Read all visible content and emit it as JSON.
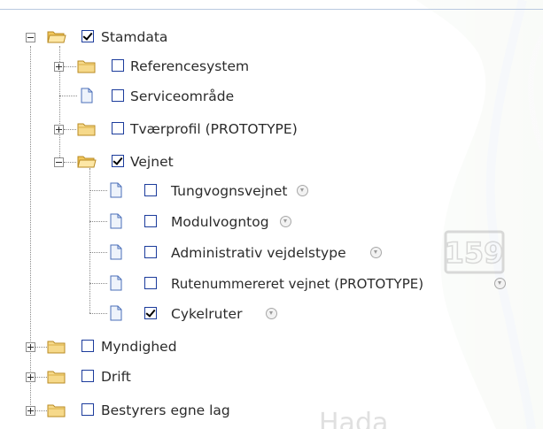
{
  "colors": {
    "accent_check_border": "#1c3c9c",
    "folder": "#f3d07a",
    "doc": "#4b6fb8"
  },
  "tree": {
    "root": {
      "label": "Stamdata",
      "checked": true,
      "expanded": true
    },
    "stamdata_children": [
      {
        "label": "Referencesystem",
        "checked": false,
        "type": "folder",
        "expanded": false
      },
      {
        "label": "Serviceområde",
        "checked": false,
        "type": "doc"
      },
      {
        "label": "Tværprofil (PROTOTYPE)",
        "checked": false,
        "type": "folder",
        "expanded": false
      },
      {
        "label": "Vejnet",
        "checked": true,
        "type": "folder",
        "expanded": true
      }
    ],
    "vejnet_children": [
      {
        "label": "Tungvognsvejnet",
        "checked": false,
        "icon": "info-dropdown-icon"
      },
      {
        "label": "Modulvogntog",
        "checked": false,
        "icon": "info-dropdown-icon"
      },
      {
        "label": "Administrativ vejdelstype",
        "checked": false,
        "icon": "info-dropdown-icon"
      },
      {
        "label": "Rutenummereret vejnet (PROTOTYPE)",
        "checked": false,
        "icon": "info-dropdown-icon"
      },
      {
        "label": "Cykelruter",
        "checked": true,
        "icon": "info-dropdown-icon"
      }
    ],
    "top_level": [
      {
        "label": "Myndighed",
        "checked": false,
        "expanded": false
      },
      {
        "label": "Drift",
        "checked": false,
        "expanded": false
      },
      {
        "label": "Bestyrers egne lag",
        "checked": false,
        "expanded": false
      }
    ]
  },
  "map": {
    "road_number": "159"
  }
}
